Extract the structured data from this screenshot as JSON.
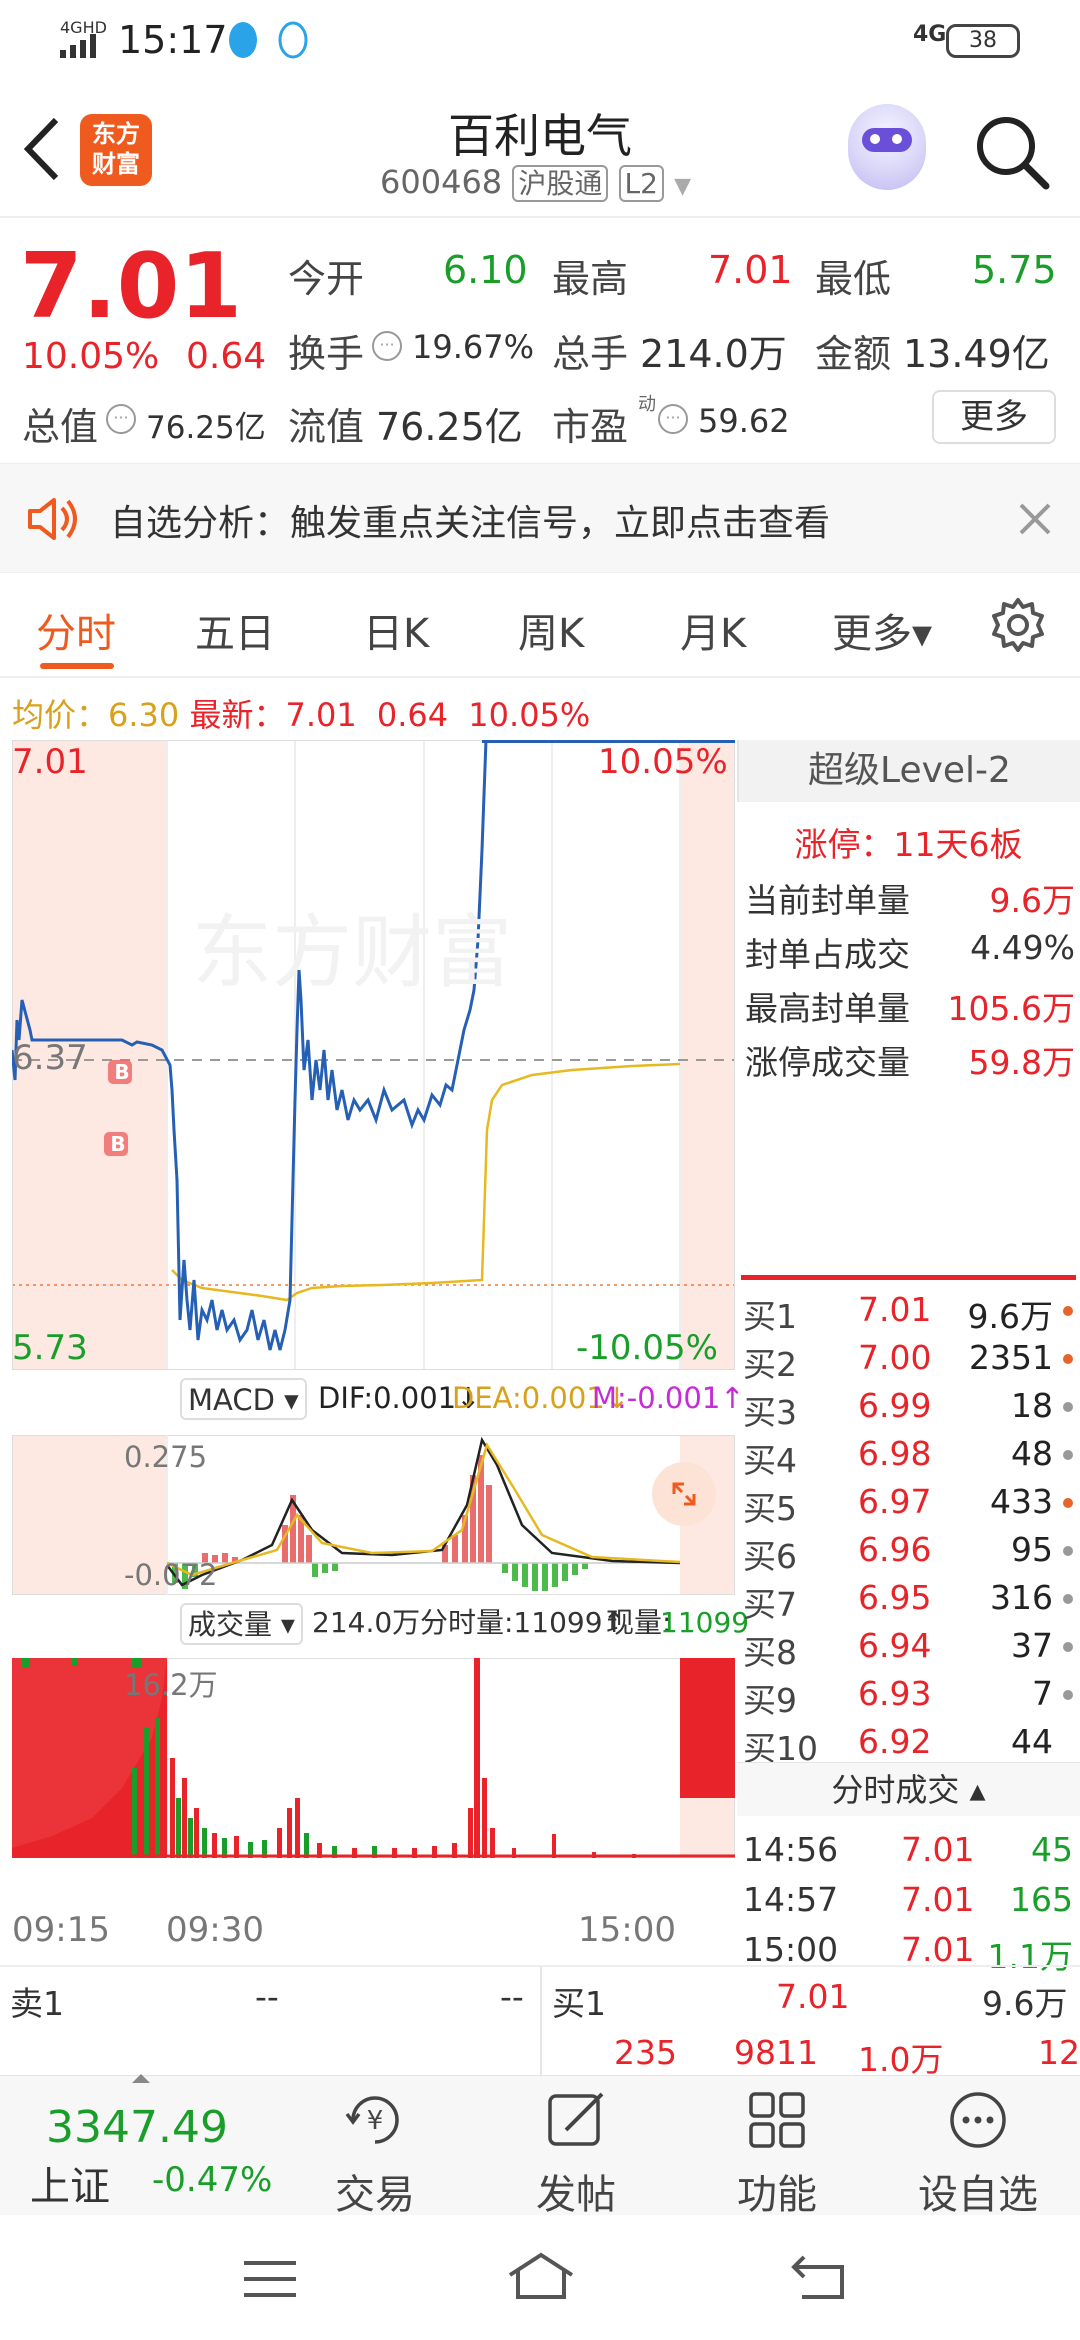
{
  "status": {
    "time": "15:17",
    "network": "4GHD",
    "sim": "4G",
    "battery": "38"
  },
  "header": {
    "title": "百利电气",
    "code": "600468",
    "market_tag": "沪股通",
    "level_tag": "L2",
    "logo": "东方\n财富"
  },
  "quote": {
    "price": "7.01",
    "change_pct": "10.05%",
    "change": "0.64",
    "open_label": "今开",
    "open": "6.10",
    "high_label": "最高",
    "high": "7.01",
    "low_label": "最低",
    "low": "5.75",
    "turnover_label": "换手",
    "turnover": "19.67%",
    "volume_label": "总手",
    "volume": "214.0万",
    "amount_label": "金额",
    "amount": "13.49亿",
    "mktcap_label": "总值",
    "mktcap": "76.25亿",
    "float_label": "流值",
    "float": "76.25亿",
    "pe_label": "市盈",
    "pe_sup": "动",
    "pe": "59.62",
    "more_button": "更多"
  },
  "notice": {
    "text": "自选分析：触发重点关注信号，立即点击查看"
  },
  "tabs": [
    "分时",
    "五日",
    "日K",
    "周K",
    "月K",
    "更多▾"
  ],
  "avg_line": {
    "avg_label": "均价：",
    "avg": "6.30",
    "latest_label": "最新：",
    "latest": "7.01",
    "chg": "0.64",
    "pct": "10.05%"
  },
  "chart": {
    "y_top": "7.01",
    "y_mid": "6.37",
    "y_bottom": "5.73",
    "pct_top": "10.05%",
    "pct_bottom": "-10.05%",
    "watermark": "东方财富",
    "marker_b1": "B",
    "marker_b2": "B",
    "macd_select": "MACD ▾",
    "dif": "DIF:0.001↓",
    "dea": "DEA:0.001↓",
    "m": "M:-0.001↑",
    "macd_top": "0.275",
    "macd_bottom": "-0.072",
    "vol_select": "成交量 ▾",
    "vol_total": "214.0万",
    "vol_period": "分时量:11099↑",
    "vol_now_label": "现量:",
    "vol_now": "11099",
    "vol_top": "16.2万",
    "time_start": "09:15",
    "time_open": "09:30",
    "time_end": "15:00"
  },
  "level2": {
    "title": "超级Level-2",
    "limit_label": "涨停：",
    "limit": "11天6板",
    "rows": [
      {
        "label": "当前封单量",
        "value": "9.6万"
      },
      {
        "label": "封单占成交",
        "value": "4.49%"
      },
      {
        "label": "最高封单量",
        "value": "105.6万"
      },
      {
        "label": "涨停成交量",
        "value": "59.8万"
      }
    ],
    "bids": [
      {
        "label": "买1",
        "price": "7.01",
        "qty": "9.6万",
        "dot": "#e8642a"
      },
      {
        "label": "买2",
        "price": "7.00",
        "qty": "2351",
        "dot": "#e8642a"
      },
      {
        "label": "买3",
        "price": "6.99",
        "qty": "18",
        "dot": "#999999"
      },
      {
        "label": "买4",
        "price": "6.98",
        "qty": "48",
        "dot": "#999999"
      },
      {
        "label": "买5",
        "price": "6.97",
        "qty": "433",
        "dot": "#e8642a"
      },
      {
        "label": "买6",
        "price": "6.96",
        "qty": "95",
        "dot": "#999999"
      },
      {
        "label": "买7",
        "price": "6.95",
        "qty": "316",
        "dot": "#999999"
      },
      {
        "label": "买8",
        "price": "6.94",
        "qty": "37",
        "dot": "#999999"
      },
      {
        "label": "买9",
        "price": "6.93",
        "qty": "7",
        "dot": "#999999"
      },
      {
        "label": "买10",
        "price": "6.92",
        "qty": "44",
        "dot": "#999999"
      }
    ],
    "ticks_title": "分时成交 ▴",
    "ticks": [
      {
        "time": "14:56",
        "price": "7.01",
        "vol": "45"
      },
      {
        "time": "14:57",
        "price": "7.01",
        "vol": "165"
      },
      {
        "time": "15:00",
        "price": "7.01",
        "vol": "1.1万"
      }
    ]
  },
  "book": {
    "ask_label": "卖1",
    "ask_price": "--",
    "ask_qty": "--",
    "bid_label": "买1",
    "bid_price": "7.01",
    "bid_qty": "9.6万",
    "n1": "235",
    "n2": "9811",
    "n3": "1.0万",
    "n4": "12"
  },
  "bottomnav": {
    "index_value": "3347.49",
    "index_name": "上证",
    "index_chg": "-0.47%",
    "items": [
      "交易",
      "发帖",
      "功能",
      "设自选"
    ]
  }
}
